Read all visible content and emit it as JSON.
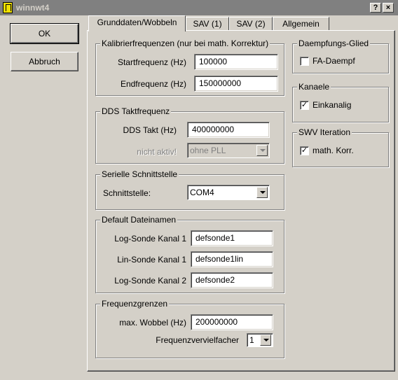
{
  "window": {
    "title": "winnwt4",
    "help_label": "?",
    "close_label": "×"
  },
  "buttons": {
    "ok": "OK",
    "cancel": "Abbruch"
  },
  "tabs": [
    {
      "label": "Grunddaten/Wobbeln"
    },
    {
      "label": "SAV (1)"
    },
    {
      "label": "SAV (2)"
    },
    {
      "label": "Allgemein"
    }
  ],
  "calibration": {
    "title": "Kalibrierfrequenzen (nur bei math. Korrektur)",
    "start_label": "Startfrequenz (Hz)",
    "start_value": "100000",
    "end_label": "Endfrequenz (Hz)",
    "end_value": "150000000"
  },
  "dds": {
    "title": "DDS Taktfrequenz",
    "takt_label": "DDS Takt (Hz)",
    "takt_value": "400000000",
    "pll_label": "nicht aktiv!",
    "pll_value": "ohne PLL"
  },
  "serial": {
    "title": "Serielle Schnittstelle",
    "port_label": "Schnittstelle:",
    "port_value": "COM4"
  },
  "files": {
    "title": "Default Dateinamen",
    "log1_label": "Log-Sonde Kanal 1",
    "log1_value": "defsonde1",
    "lin1_label": "Lin-Sonde Kanal 1",
    "lin1_value": "defsonde1lin",
    "log2_label": "Log-Sonde Kanal 2",
    "log2_value": "defsonde2"
  },
  "limits": {
    "title": "Frequenzgrenzen",
    "wobbel_label": "max. Wobbel (Hz)",
    "wobbel_value": "200000000",
    "mult_label": "Frequenzvervielfacher",
    "mult_value": "1"
  },
  "attenuator": {
    "title": "Daempfungs-Glied",
    "fa_label": "FA-Daempf",
    "fa_checked": false
  },
  "channels": {
    "title": "Kanaele",
    "single_label": "Einkanalig",
    "single_checked": true
  },
  "swv": {
    "title": "SWV Iteration",
    "math_label": "math. Korr.",
    "math_checked": true
  }
}
